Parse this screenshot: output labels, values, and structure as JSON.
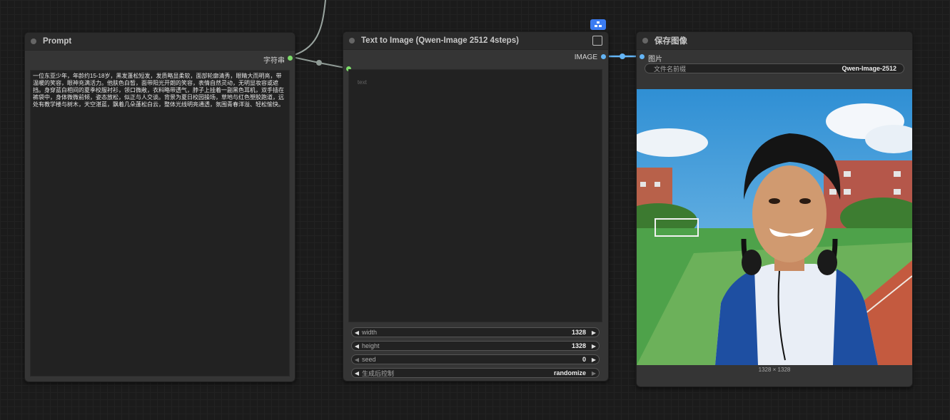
{
  "canvas": {
    "background": "#1b1b1b"
  },
  "nodes": {
    "prompt": {
      "title": "Prompt",
      "output_label": "字符串",
      "text": "一位东亚少年，年龄约15-18岁，黑发蓬松短发，发质略显柔软，面部轮廓清秀，眼睛大而明亮，带温暖的笑容，眼神充满活力。他肤色白皙，面带阳光开朗的笑容，表情自然灵动，无明显妆容或遮挡。身穿蓝白相间的夏季校服衬衫，领口微敞，衣料略带透气，脖子上挂着一副黑色耳机，双手插在裤袋中，身体微微前倾，姿态放松，似正与人交谈。背景为夏日校园操场，草地与红色塑胶跑道，远处有教学楼与树木，天空湛蓝，飘着几朵蓬松白云，整体光线明亮通透，氛围青春洋溢、轻松愉快。"
    },
    "text_to_image": {
      "title": "Text to Image (Qwen-Image 2512 4steps)",
      "output_label": "IMAGE",
      "input_label": "text",
      "widgets": [
        {
          "label": "width",
          "value": "1328"
        },
        {
          "label": "height",
          "value": "1328"
        },
        {
          "label": "seed",
          "value": "0"
        },
        {
          "label": "生成后控制",
          "value": "randomize"
        }
      ]
    },
    "save_image": {
      "title": "保存图像",
      "input_label": "图片",
      "filename_label": "文件名前缀",
      "filename_value": "Qwen-Image-2512",
      "image_caption": "1328 × 1328",
      "image_description": "Generated photo: smiling teen boy with black hair wearing a blue and white polo shirt and black headphones around his neck, leaning forward on a school sports field with a red running track, green grass, brick school buildings and blue sky with white clouds."
    }
  },
  "colors": {
    "string_port": "#7ddc6a",
    "image_port": "#64b5f6",
    "badge": "#3b7cf2",
    "wire_gray": "#9aa5a0"
  },
  "icons": {
    "badge_icon": "node-group-icon",
    "expand_icon": "open-in-new-icon"
  }
}
